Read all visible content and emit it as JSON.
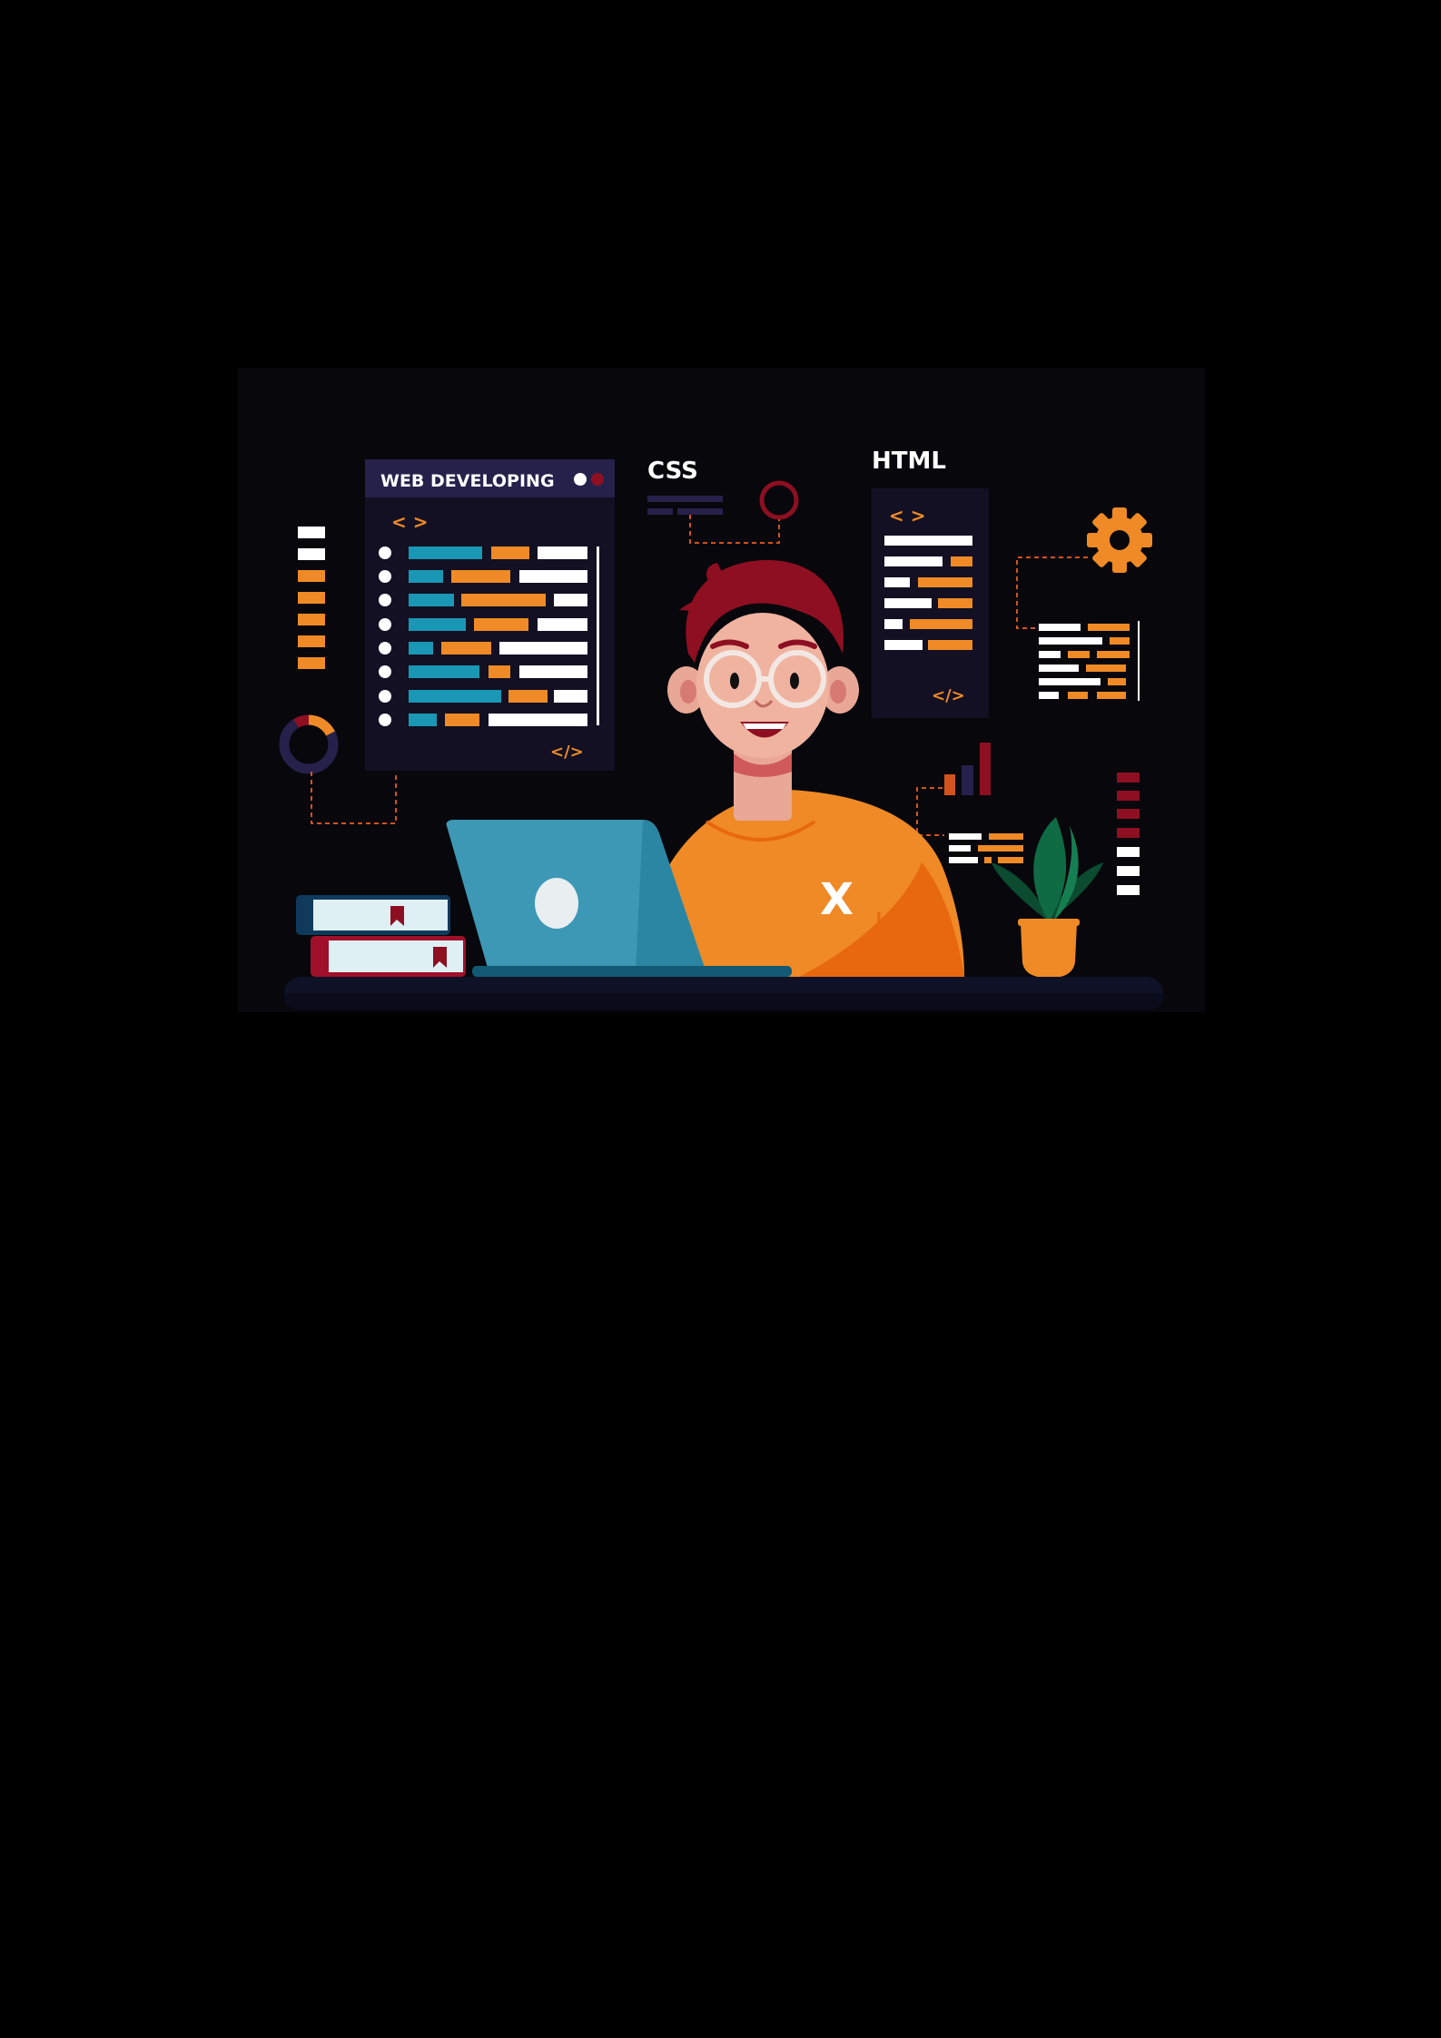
{
  "panel": {
    "title": "WEB DEVELOPING",
    "open_tag": "< >",
    "close_tag": "</>"
  },
  "css_label": "CSS",
  "html_card": {
    "title": "HTML",
    "open_tag": "< >",
    "close_tag": "</>"
  },
  "shirt_letter": "X",
  "colors": {
    "background": "#000000",
    "scene": "#07070c",
    "panel": "#121022",
    "panel_header": "#25214a",
    "orange": "#ef8a26",
    "teal": "#1a97b5",
    "crimson": "#8e0f21",
    "laptop": "#3c98b5",
    "plant": "#0f6b43",
    "skin": "#e9a895"
  },
  "icons": [
    "gear-icon",
    "donut-chart-icon",
    "ring-icon",
    "bar-chart-icon",
    "bookmark-icon"
  ]
}
